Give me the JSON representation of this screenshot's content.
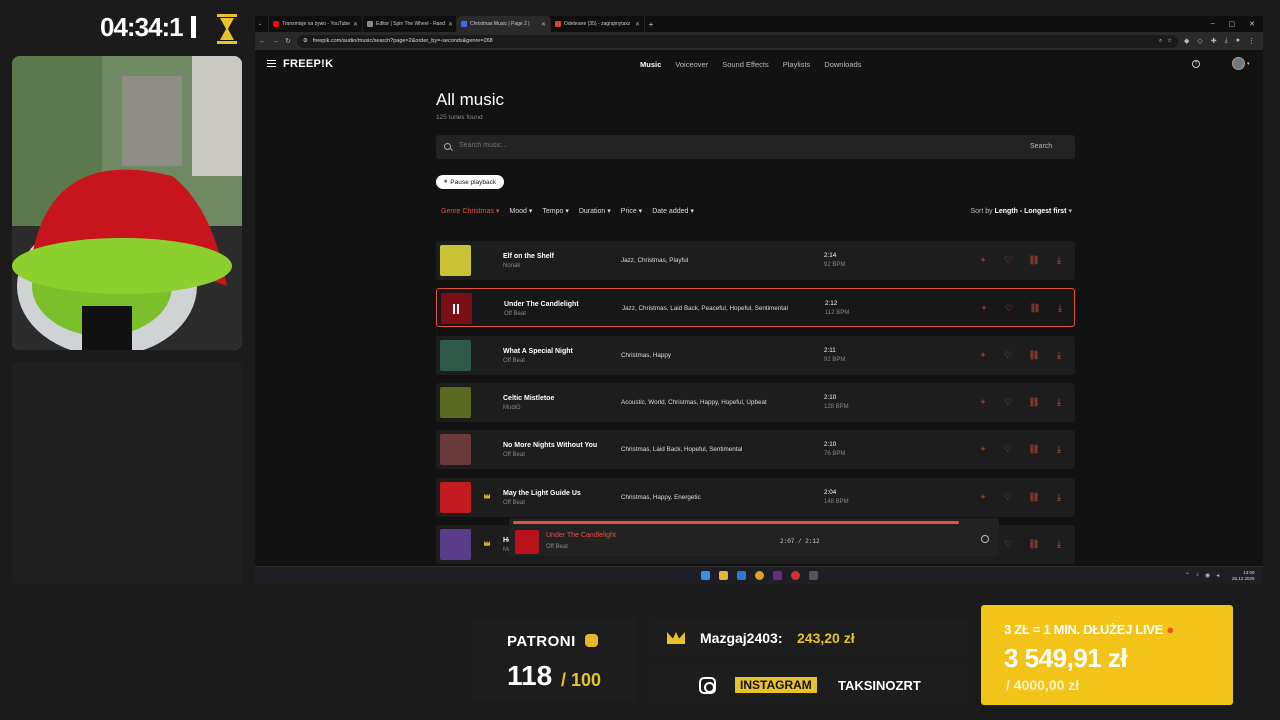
{
  "stream": {
    "timer": "04:34:1",
    "patroni_label": "PATRONI",
    "patroni_count": "118",
    "patroni_goal": "/ 100",
    "top_donor_name": "Mazgaj2403:",
    "top_donor_amount": "243,20 zł",
    "social_label": "INSTAGRAM",
    "social_handle": "TAKSINOZRT",
    "goal_rule": "3 ZŁ = 1 MIN. DŁUŻEJ LIVE",
    "goal_amount": "3 549,91 zł",
    "goal_target": "/ 4000,00 zł"
  },
  "browser": {
    "tabs": [
      {
        "label": "Transmisje na żywo - YouTube",
        "color": "#ff0000"
      },
      {
        "label": "Editor | Spin The Wheel - Rand",
        "color": "#8a8a8a"
      },
      {
        "label": "Christmas Music | Page 2 |",
        "color": "#3b6df2",
        "active": true
      },
      {
        "label": "Odebrane (35) - zagrajmytaxz",
        "color": "#d44638"
      }
    ],
    "url": "freepik.com/audio/music/search?page=2&order_by=-seconds&genre=268"
  },
  "site": {
    "logo": "FREEP!K",
    "nav": [
      "Music",
      "Voiceover",
      "Sound Effects",
      "Playlists",
      "Downloads"
    ],
    "nav_active": "Music",
    "title": "All music",
    "count": "125 tunes found",
    "search_placeholder": "Search music...",
    "search_button": "Search",
    "pause_button": "Pause playback",
    "filters": [
      {
        "label": "Genre Christmas",
        "active": true
      },
      {
        "label": "Mood"
      },
      {
        "label": "Tempo"
      },
      {
        "label": "Duration"
      },
      {
        "label": "Price"
      },
      {
        "label": "Date added"
      }
    ],
    "sort_prefix": "Sort by",
    "sort_value": "Length - Longest first"
  },
  "tracks": [
    {
      "name": "Elf on the Shelf",
      "artist": "Nonak",
      "tags": "Jazz, Christmas, Playful",
      "duration": "2:14",
      "bpm": "92 BPM",
      "color": "#c9c234",
      "premium": false,
      "playing": false
    },
    {
      "name": "Under The Candlelight",
      "artist": "Off Beat",
      "tags": "Jazz, Christmas, Laid Back, Peaceful, Hopeful, Sentimental",
      "duration": "2:12",
      "bpm": "112 BPM",
      "color": "#7a0f16",
      "premium": false,
      "playing": true
    },
    {
      "name": "What A Special Night",
      "artist": "Off Beat",
      "tags": "Christmas, Happy",
      "duration": "2:11",
      "bpm": "92 BPM",
      "color": "#2f5a4a",
      "premium": false,
      "playing": false
    },
    {
      "name": "Celtic Mistletoe",
      "artist": "MudiG",
      "tags": "Acoustic, World, Christmas, Happy, Hopeful, Upbeat",
      "duration": "2:10",
      "bpm": "128 BPM",
      "color": "#5a6a22",
      "premium": false,
      "playing": false
    },
    {
      "name": "No More Nights Without You",
      "artist": "Off Beat",
      "tags": "Christmas, Laid Back, Hopeful, Sentimental",
      "duration": "2:10",
      "bpm": "76 BPM",
      "color": "#6a3a3a",
      "premium": false,
      "playing": false
    },
    {
      "name": "May the Light Guide Us",
      "artist": "Off Beat",
      "tags": "Christmas, Happy, Energetic",
      "duration": "2:04",
      "bpm": "148 BPM",
      "color": "#c41a22",
      "premium": true,
      "playing": false
    },
    {
      "name": "Ho",
      "artist": "Ma",
      "tags": "",
      "duration": "",
      "bpm": "",
      "color": "#5b3c8a",
      "premium": true,
      "playing": false
    }
  ],
  "player": {
    "title": "Under The Candlelight",
    "artist": "Off Beat",
    "time": "2:07 / 2:12",
    "progress": 0.96
  },
  "taskbar": {
    "time": "13:09",
    "date": "26.12.2025"
  },
  "colors": {
    "accent": "#e5533f",
    "gold": "#e8c22a",
    "goal_bg": "#f2c318"
  }
}
